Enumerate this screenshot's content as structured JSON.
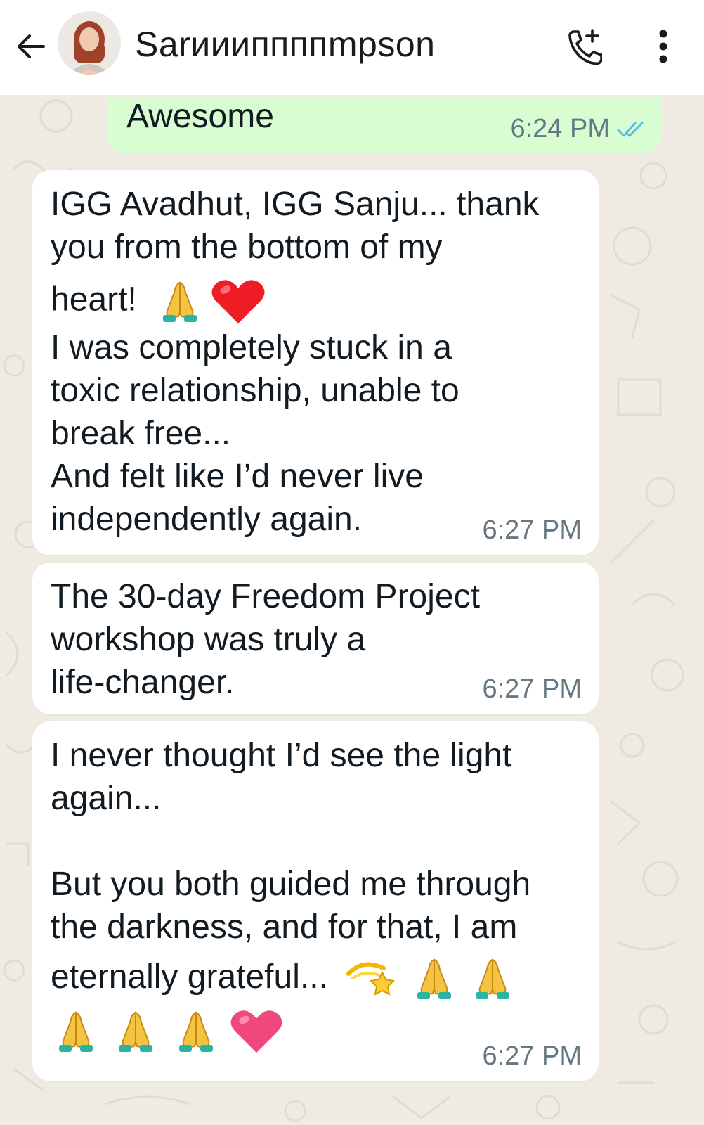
{
  "header": {
    "contact_name": "Sarиииппппmpson",
    "back_icon": "arrow-left-icon",
    "call_icon": "phone-add-icon",
    "menu_icon": "more-vertical-icon"
  },
  "messages": [
    {
      "direction": "outgoing",
      "text": "Awesome",
      "time": "6:24 PM",
      "status": "read"
    },
    {
      "direction": "incoming",
      "lines": [
        "IGG Avadhut, IGG Sanju... thank",
        "you from the bottom of my",
        "heart!",
        "I was completely stuck in a",
        "toxic relationship, unable to",
        "break free...",
        "And felt like I’d never live",
        "independently again."
      ],
      "emoji_after_heart": [
        "folded-hands",
        "red-heart"
      ],
      "time": "6:27 PM"
    },
    {
      "direction": "incoming",
      "lines": [
        "The 30-day Freedom Project",
        "workshop was truly a",
        "life-changer."
      ],
      "time": "6:27 PM"
    },
    {
      "direction": "incoming",
      "lines": [
        "I never thought I’d see the light",
        "again...",
        "",
        "But you both guided me through",
        "the darkness, and for that, I am",
        "eternally grateful..."
      ],
      "emoji_trailing": [
        "dizzy-star",
        "folded-hands",
        "folded-hands"
      ],
      "emoji_last_line": [
        "folded-hands",
        "folded-hands",
        "folded-hands",
        "pink-heart"
      ],
      "time": "6:27 PM"
    }
  ],
  "colors": {
    "wallpaper": "#efeae2",
    "outgoing_bubble": "#d9fdd3",
    "incoming_bubble": "#ffffff",
    "read_ticks": "#53bdeb",
    "meta_text": "#667781"
  }
}
